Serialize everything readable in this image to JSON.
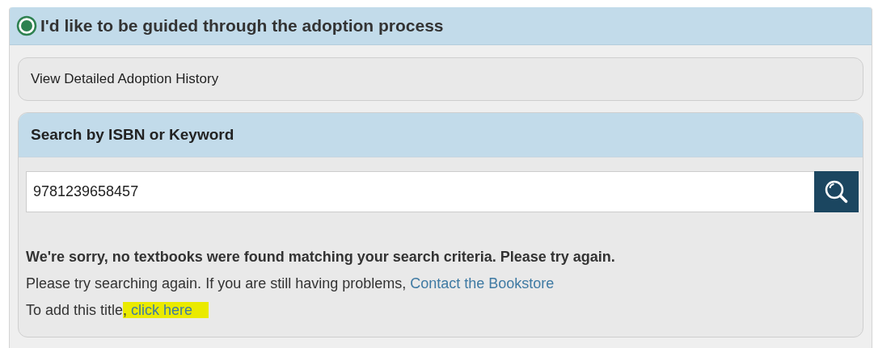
{
  "option": {
    "label": "I'd like to be guided through the adoption process",
    "selected": true
  },
  "history_link": "View Detailed Adoption History",
  "search": {
    "title": "Search by ISBN or Keyword",
    "value": "9781239658457"
  },
  "results": {
    "message": "We're sorry, no textbooks were found matching your search criteria. Please try again.",
    "help": {
      "text": "Please try searching again. If you are still having problems, ",
      "link": "Contact the Bookstore"
    },
    "add_title": {
      "text": "To add this title",
      "separator": ", ",
      "link": "click here",
      "highlighted": true
    }
  }
}
